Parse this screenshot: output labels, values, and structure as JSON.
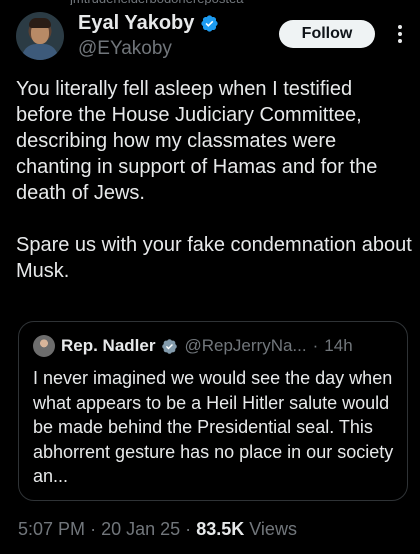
{
  "repost_label": "jmtrudeneiderbodonerepostea",
  "author": {
    "display_name": "Eyal Yakoby",
    "handle": "@EYakoby"
  },
  "follow_label": "Follow",
  "tweet_text": "You literally fell asleep when I testified before the House Judiciary Committee, describing how my classmates were chanting in support of Hamas and for the death of Jews.\n\nSpare us with your fake condemnation about Musk.",
  "quoted": {
    "display_name": "Rep. Nadler",
    "handle": "@RepJerryNa...",
    "separator": "·",
    "time": "14h",
    "text": "I never imagined we would see the day when what appears to be a Heil Hitler salute would be made behind the Presidential seal. This abhorrent gesture has no place in our society an..."
  },
  "meta": {
    "time": "5:07 PM",
    "date": "20 Jan 25",
    "views_count": "83.5K",
    "views_label": "Views",
    "separator": "·"
  },
  "colors": {
    "background": "#000000",
    "text": "#e7e9ea",
    "muted": "#71767b",
    "verified_blue": "#1d9bf0",
    "government_gray": "#829aab",
    "border": "#2f3336"
  }
}
